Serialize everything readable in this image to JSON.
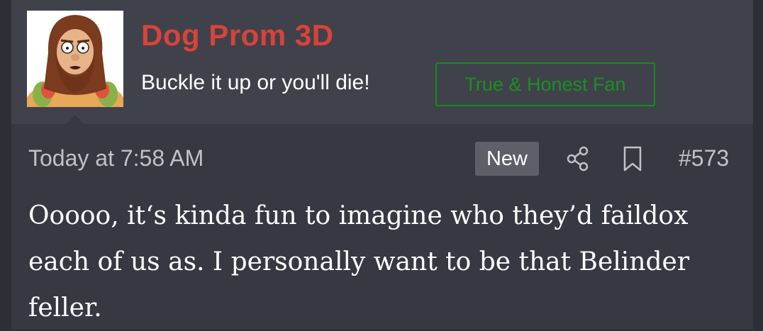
{
  "post": {
    "username": "Dog Prom 3D",
    "user_title": "Buckle it up or you'll die!",
    "user_banner": "True & Honest Fan",
    "date": "Today at 7:58 AM",
    "new_badge": "New",
    "post_number": "#573",
    "body": "Ooooo, it‘s kinda fun to imagine who they’d faildox each of us as. I personally want to be that Belinder feller."
  },
  "colors": {
    "username": "#d8433a",
    "banner_green": "#188a1d",
    "header_bg": "#3f424b",
    "post_bg": "#363941"
  },
  "icons": [
    "avatar-bearded-man",
    "share-icon",
    "bookmark-icon"
  ]
}
